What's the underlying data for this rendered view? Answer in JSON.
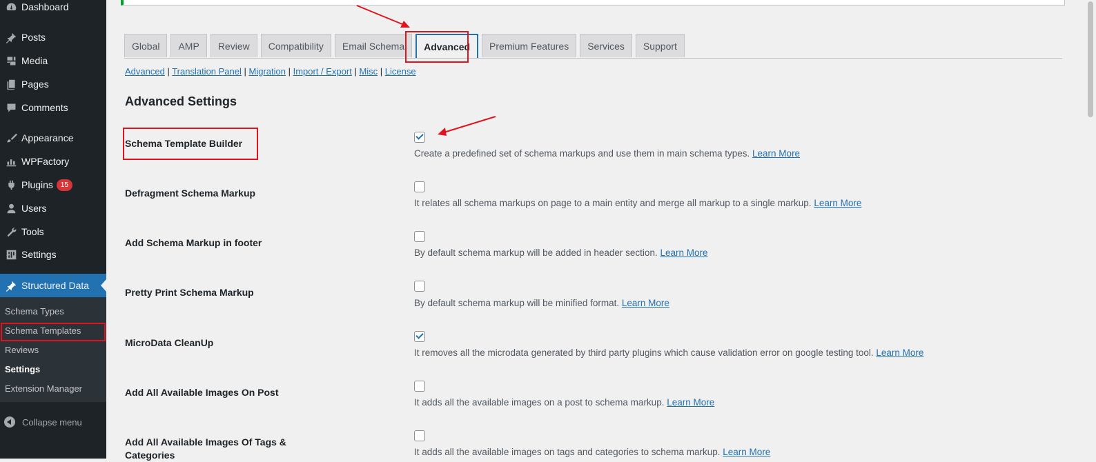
{
  "sidebar": {
    "items": [
      {
        "label": "Dashboard",
        "icon": "dashboard-icon"
      },
      {
        "label": "Posts",
        "icon": "pin-icon"
      },
      {
        "label": "Media",
        "icon": "media-icon"
      },
      {
        "label": "Pages",
        "icon": "pages-icon"
      },
      {
        "label": "Comments",
        "icon": "comment-icon"
      },
      {
        "label": "Appearance",
        "icon": "brush-icon"
      },
      {
        "label": "WPFactory",
        "icon": "chart-icon"
      },
      {
        "label": "Plugins",
        "icon": "plug-icon",
        "badge": "15"
      },
      {
        "label": "Users",
        "icon": "user-icon"
      },
      {
        "label": "Tools",
        "icon": "wrench-icon"
      },
      {
        "label": "Settings",
        "icon": "settings-icon"
      },
      {
        "label": "Structured Data",
        "icon": "pin-icon",
        "active": true
      }
    ],
    "submenu": [
      {
        "label": "Schema Types"
      },
      {
        "label": "Schema Templates",
        "highlighted": true
      },
      {
        "label": "Reviews"
      },
      {
        "label": "Settings",
        "current": true
      },
      {
        "label": "Extension Manager"
      }
    ],
    "collapse_label": "Collapse menu"
  },
  "tabs": [
    {
      "label": "Global"
    },
    {
      "label": "AMP"
    },
    {
      "label": "Review"
    },
    {
      "label": "Compatibility"
    },
    {
      "label": "Email Schema"
    },
    {
      "label": "Advanced",
      "active": true
    },
    {
      "label": "Premium Features"
    },
    {
      "label": "Services"
    },
    {
      "label": "Support"
    }
  ],
  "subnav": {
    "links": [
      "Advanced",
      "Translation Panel",
      "Migration",
      "Import / Export",
      "Misc",
      "License"
    ],
    "separator": " | "
  },
  "section_title": "Advanced Settings",
  "settings": [
    {
      "label": "Schema Template Builder",
      "checked": true,
      "description": "Create a predefined set of schema markups and use them in main schema types.",
      "link": "Learn More"
    },
    {
      "label": "Defragment Schema Markup",
      "checked": false,
      "description": "It relates all schema markups on page to a main entity and merge all markup to a single markup.",
      "link": "Learn More"
    },
    {
      "label": "Add Schema Markup in footer",
      "checked": false,
      "description": "By default schema markup will be added in header section.",
      "link": "Learn More"
    },
    {
      "label": "Pretty Print Schema Markup",
      "checked": false,
      "description": "By default schema markup will be minified format.",
      "link": "Learn More"
    },
    {
      "label": "MicroData CleanUp",
      "checked": true,
      "description": "It removes all the microdata generated by third party plugins which cause validation error on google testing tool.",
      "link": "Learn More"
    },
    {
      "label": "Add All Available Images On Post",
      "checked": false,
      "description": "It adds all the available images on a post to schema markup.",
      "link": "Learn More"
    },
    {
      "label": "Add All Available Images Of Tags & Categories",
      "checked": false,
      "description": "It adds all the available images on tags and categories to schema markup.",
      "link": "Learn More"
    }
  ],
  "colors": {
    "sidebar_bg": "#1d2327",
    "accent": "#2271b1",
    "annotation_red": "#e0141e",
    "badge_red": "#d63638"
  }
}
